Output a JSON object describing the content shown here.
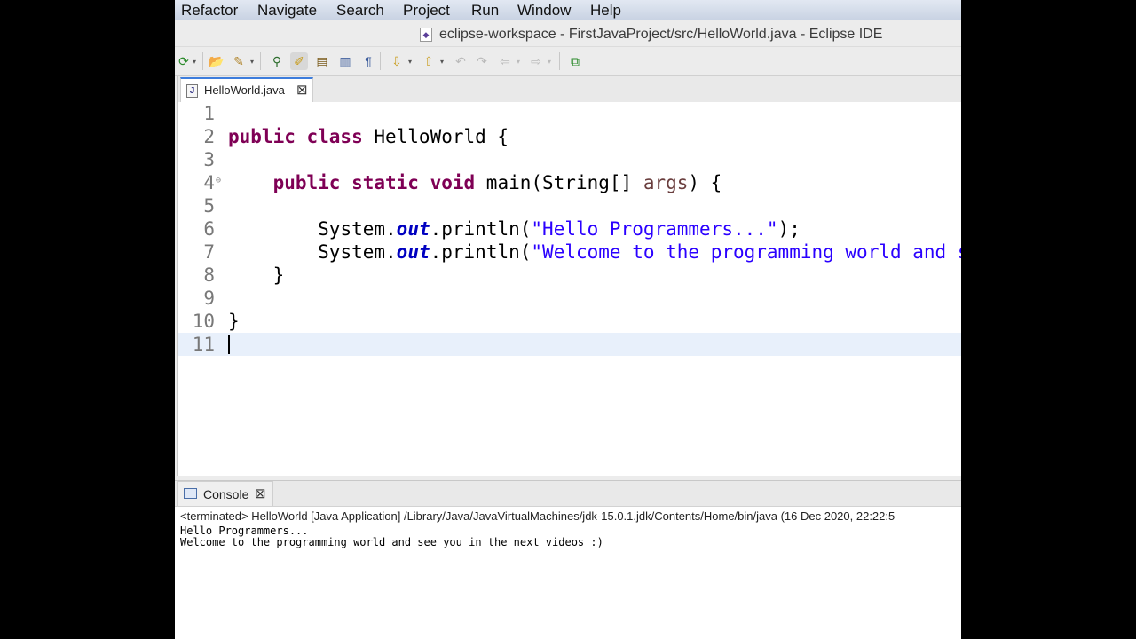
{
  "menubar": {
    "items": [
      "Refactor",
      "Navigate",
      "Search",
      "Project",
      "Run",
      "Window",
      "Help"
    ]
  },
  "window": {
    "title": "eclipse-workspace - FirstJavaProject/src/HelloWorld.java - Eclipse IDE"
  },
  "toolbar": {
    "icons": [
      "run-last-tool-icon",
      "open-type-icon",
      "open-task-icon",
      "search-icon",
      "toggle-mark-occurrences-icon",
      "toggle-block-selection-icon",
      "toggle-word-wrap-icon",
      "show-whitespace-icon",
      "next-annotation-icon",
      "previous-annotation-icon",
      "last-edit-location-icon",
      "forward-edit-icon",
      "back-icon",
      "forward-icon",
      "pin-editor-icon"
    ]
  },
  "editor": {
    "tab_label": "HelloWorld.java",
    "tab_icon": "J",
    "lines": [
      {
        "n": "1"
      },
      {
        "n": "2"
      },
      {
        "n": "3"
      },
      {
        "n": "4"
      },
      {
        "n": "5"
      },
      {
        "n": "6"
      },
      {
        "n": "7"
      },
      {
        "n": "8"
      },
      {
        "n": "9"
      },
      {
        "n": "10"
      },
      {
        "n": "11"
      }
    ],
    "fold_marker": "⊖",
    "code": {
      "l2_kw": "public class",
      "l2_rest": " HelloWorld {",
      "l4_kw": "public static void",
      "l4_rest": " main(String[] ",
      "l4_param": "args",
      "l4_end": ") {",
      "l6_sys": "System.",
      "l6_out": "out",
      "l6_call": ".println(",
      "l6_str": "\"Hello Programmers...\"",
      "l6_end": ");",
      "l7_sys": "System.",
      "l7_out": "out",
      "l7_call": ".println(",
      "l7_str": "\"Welcome to the programming world and see you in the next videos :)\"",
      "l7_end": ");",
      "l8": "}",
      "l10": "}"
    }
  },
  "console": {
    "tab_label": "Console",
    "status": "<terminated> HelloWorld [Java Application] /Library/Java/JavaVirtualMachines/jdk-15.0.1.jdk/Contents/Home/bin/java  (16 Dec 2020, 22:22:5",
    "output": [
      "Hello Programmers...",
      "Welcome to the programming world and see you in the next videos :)"
    ]
  },
  "colors": {
    "keyword": "#7f0055",
    "string": "#2a00ff",
    "field": "#0000c0",
    "current_line": "#e8f0fb"
  }
}
